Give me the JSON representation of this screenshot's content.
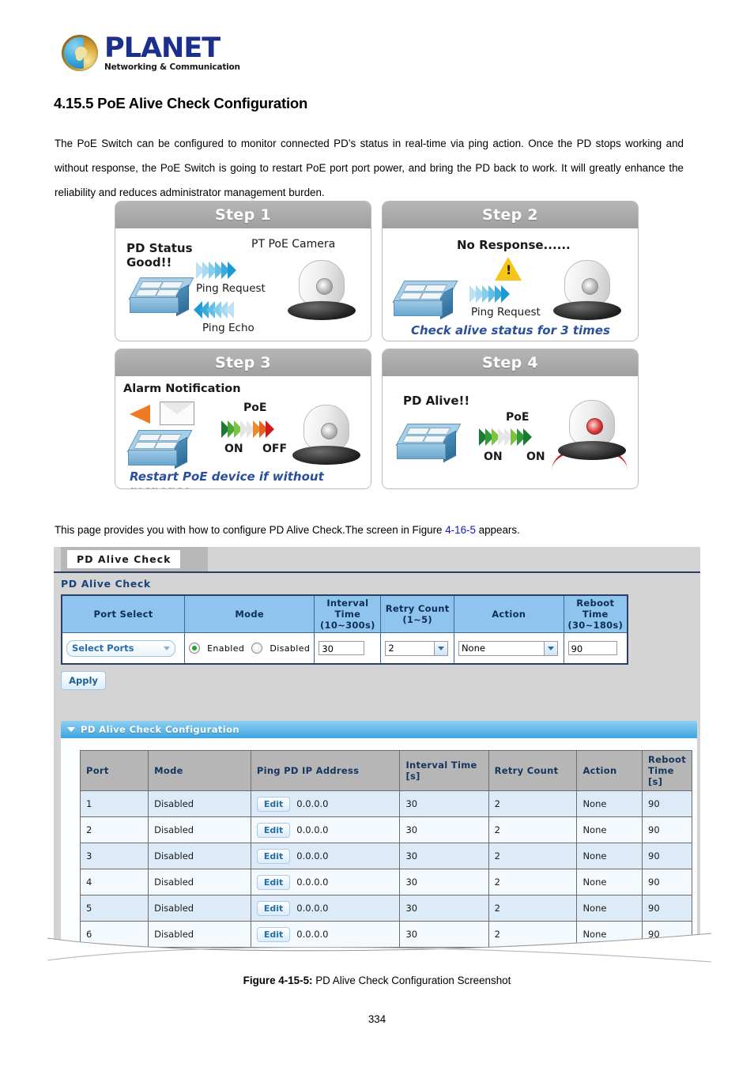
{
  "brand": {
    "name": "PLANET",
    "tagline": "Networking & Communication",
    "logo_icon": "planet-globe-icon",
    "brand_color": "#1d2f8c"
  },
  "document": {
    "section_number_and_title": "4.15.5 PoE Alive Check Configuration",
    "intro_paragraph": "The PoE Switch can be configured to monitor connected PD’s status in real-time via ping action. Once the PD stops working and without response, the PoE Switch is going to restart PoE port port power, and bring the PD back to work. It will greatly enhance the reliability and reduces administrator management burden.",
    "screen_ref_prefix": "This page provides you with how to configure PD Alive Check.The screen in Figure ",
    "screen_ref_link": "4-16-5",
    "screen_ref_suffix": " appears.",
    "figure_caption_bold": "Figure 4-15-5:",
    "figure_caption_text": " PD Alive Check Configuration Screenshot",
    "page_number": "334",
    "link_color": "#1414d2"
  },
  "steps": [
    {
      "title": "Step 1",
      "device_label": "PD Status\nGood!!",
      "device_label_line1": "PD Status",
      "device_label_line2": "Good!!",
      "peer_label": "PT PoE Camera",
      "arrow_forward_label": "Ping Request",
      "arrow_back_label": "Ping Echo",
      "footer": ""
    },
    {
      "title": "Step 2",
      "status_label": "No Response......",
      "arrow_forward_label": "Ping Request",
      "footer": "Check alive status for 3 times",
      "warning_icon": "warning-triangle-icon"
    },
    {
      "title": "Step 3",
      "alarm_label": "Alarm Notification",
      "poe_label": "PoE",
      "state_from": "ON",
      "state_to": "OFF",
      "footer": "Restart PoE device if without response",
      "mail_icon": "envelope-icon"
    },
    {
      "title": "Step 4",
      "device_label": "PD Alive!!",
      "poe_label": "PoE",
      "state_from": "ON",
      "state_to": "ON",
      "footer": ""
    }
  ],
  "ui": {
    "tab_label": "PD Alive Check",
    "panel_title": "PD Alive Check",
    "form": {
      "headers": [
        "Port Select",
        "Mode",
        "Interval Time\n(10~300s)",
        "Retry Count\n(1~5)",
        "Action",
        "Reboot Time\n(30~180s)"
      ],
      "headers_parts": [
        {
          "line1": "Port Select",
          "line2": ""
        },
        {
          "line1": "Mode",
          "line2": ""
        },
        {
          "line1": "Interval Time",
          "line2": "(10~300s)"
        },
        {
          "line1": "Retry Count",
          "line2": "(1~5)"
        },
        {
          "line1": "Action",
          "line2": ""
        },
        {
          "line1": "Reboot Time",
          "line2": "(30~180s)"
        }
      ],
      "port_select_value": "Select Ports",
      "mode_enabled_label": "Enabled",
      "mode_disabled_label": "Disabled",
      "mode_selected": "Enabled",
      "interval_time_value": "30",
      "retry_count_value": "2",
      "action_value": "None",
      "reboot_time_value": "90"
    },
    "apply_label": "Apply",
    "config_section_title": "PD Alive Check Configuration",
    "table": {
      "headers": [
        {
          "line1": "Port",
          "line2": ""
        },
        {
          "line1": "Mode",
          "line2": ""
        },
        {
          "line1": "Ping PD IP Address",
          "line2": ""
        },
        {
          "line1": "Interval Time",
          "line2": "[s]"
        },
        {
          "line1": "Retry Count",
          "line2": ""
        },
        {
          "line1": "Action",
          "line2": ""
        },
        {
          "line1": "Reboot Time",
          "line2": "[s]"
        }
      ],
      "edit_label": "Edit",
      "rows": [
        {
          "port": "1",
          "mode": "Disabled",
          "ip": "0.0.0.0",
          "interval": "30",
          "retry": "2",
          "action": "None",
          "reboot": "90"
        },
        {
          "port": "2",
          "mode": "Disabled",
          "ip": "0.0.0.0",
          "interval": "30",
          "retry": "2",
          "action": "None",
          "reboot": "90"
        },
        {
          "port": "3",
          "mode": "Disabled",
          "ip": "0.0.0.0",
          "interval": "30",
          "retry": "2",
          "action": "None",
          "reboot": "90"
        },
        {
          "port": "4",
          "mode": "Disabled",
          "ip": "0.0.0.0",
          "interval": "30",
          "retry": "2",
          "action": "None",
          "reboot": "90"
        },
        {
          "port": "5",
          "mode": "Disabled",
          "ip": "0.0.0.0",
          "interval": "30",
          "retry": "2",
          "action": "None",
          "reboot": "90"
        },
        {
          "port": "6",
          "mode": "Disabled",
          "ip": "0.0.0.0",
          "interval": "30",
          "retry": "2",
          "action": "None",
          "reboot": "90"
        }
      ]
    }
  }
}
